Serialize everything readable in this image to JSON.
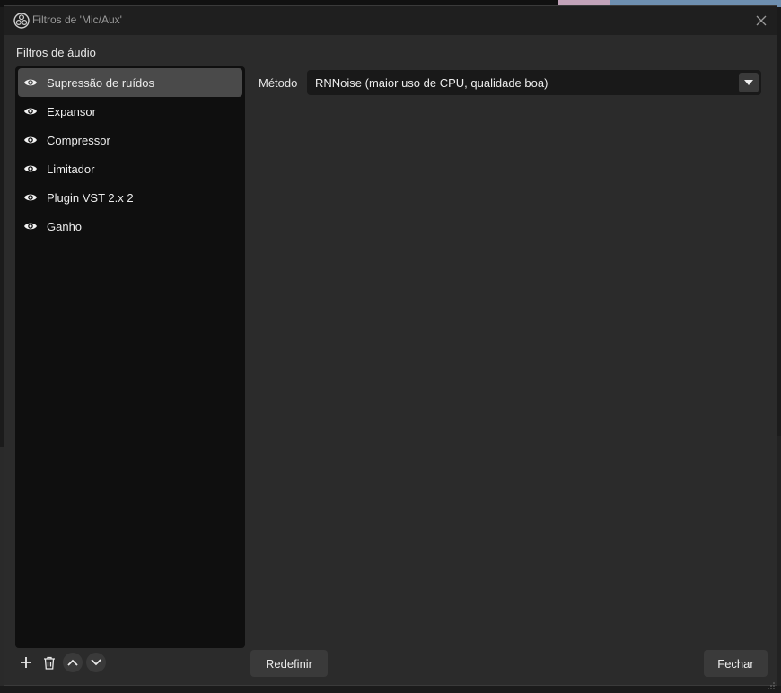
{
  "window": {
    "title": "Filtros de 'Mic/Aux'",
    "app_icon": "obs-icon",
    "close_icon": "close-icon"
  },
  "filters_section": {
    "label": "Filtros de áudio",
    "items": [
      {
        "label": "Supressão de ruídos",
        "selected": true,
        "icon": "eye-icon"
      },
      {
        "label": "Expansor",
        "selected": false,
        "icon": "eye-icon"
      },
      {
        "label": "Compressor",
        "selected": false,
        "icon": "eye-icon"
      },
      {
        "label": "Limitador",
        "selected": false,
        "icon": "eye-icon"
      },
      {
        "label": "Plugin VST 2.x 2",
        "selected": false,
        "icon": "eye-icon"
      },
      {
        "label": "Ganho",
        "selected": false,
        "icon": "eye-icon"
      }
    ],
    "toolbar": [
      "plus-icon",
      "trash-icon",
      "chevron-up-icon",
      "chevron-down-icon"
    ]
  },
  "properties": {
    "method_label": "Método",
    "method_value": "RNNoise (maior uso de CPU, qualidade boa)"
  },
  "buttons": {
    "reset": "Redefinir",
    "close": "Fechar"
  },
  "colors": {
    "dialog_bg": "#2b2b2b",
    "titlebar_bg": "#1f1f1f",
    "list_bg": "#0f0f0f",
    "selected_bg": "#4a4a4a",
    "button_bg": "#3a3a3a"
  }
}
